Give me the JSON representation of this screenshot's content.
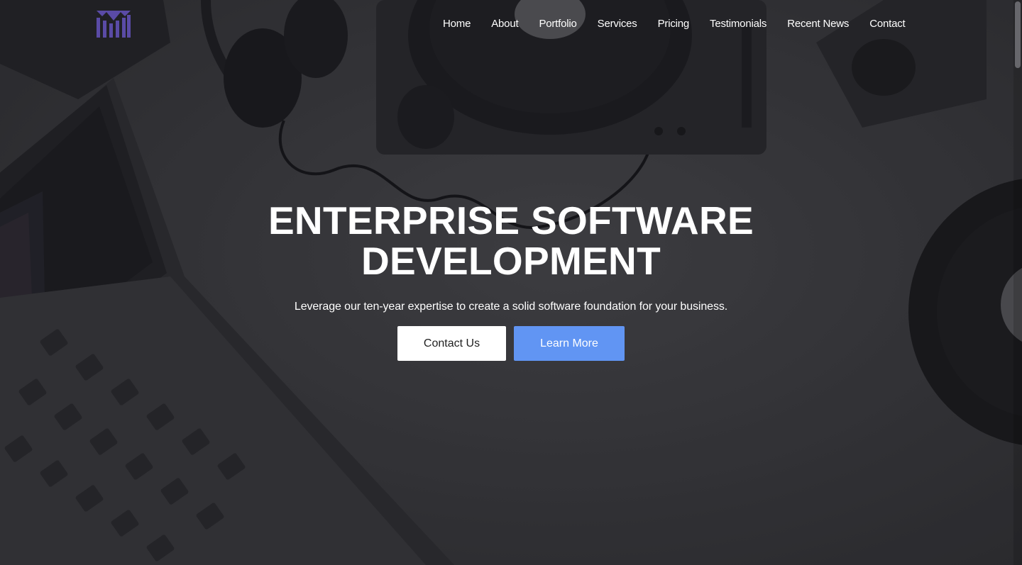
{
  "nav": {
    "logo_name": "brand-logo",
    "items": [
      {
        "label": "Home"
      },
      {
        "label": "About"
      },
      {
        "label": "Portfolio"
      },
      {
        "label": "Services"
      },
      {
        "label": "Pricing"
      },
      {
        "label": "Testimonials"
      },
      {
        "label": "Recent News"
      },
      {
        "label": "Contact"
      }
    ]
  },
  "hero": {
    "title_line1": "ENTERPRISE SOFTWARE",
    "title_line2": "DEVELOPMENT",
    "subtitle": "Leverage our ten-year expertise to create a solid software foundation for your business.",
    "primary_button": "Contact Us",
    "secondary_button": "Learn More"
  },
  "colors": {
    "accent": "#6195f3",
    "logo": "#5a4ba6",
    "text": "#ffffff",
    "overlay": "#3a3a3d"
  }
}
